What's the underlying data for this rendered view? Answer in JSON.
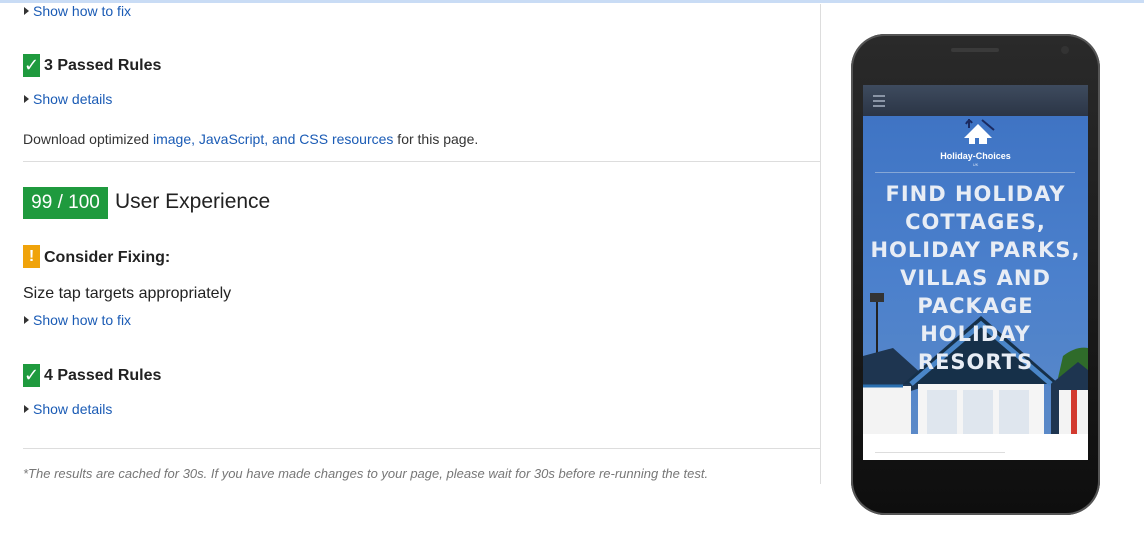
{
  "top_section": {
    "show_how_to_fix_1": "Show how to fix",
    "passed_rules_title": "3 Passed Rules",
    "show_details_1": "Show details",
    "download_prefix": "Download optimized ",
    "download_link": "image, JavaScript, and CSS resources",
    "download_suffix": " for this page."
  },
  "user_experience": {
    "score": "99 / 100",
    "label": "User Experience",
    "consider_fixing_title": "Consider Fixing:",
    "rule_text": "Size tap targets appropriately",
    "show_how_to_fix_2": "Show how to fix",
    "passed_rules_title": "4 Passed Rules",
    "show_details_2": "Show details"
  },
  "cache_note": "*The results are cached for 30s. If you have made changes to your page, please wait for 30s before re-running the test.",
  "phone_preview": {
    "logo_text": "Holiday-Choices",
    "logo_sub": "UK",
    "headline_lines": [
      "FIND HOLIDAY",
      "COTTAGES,",
      "HOLIDAY PARKS,",
      "VILLAS AND",
      "PACKAGE",
      "HOLIDAY",
      "RESORTS"
    ]
  },
  "colors": {
    "pass_green": "#1f9a3e",
    "warn_orange": "#f0a30a",
    "link_blue": "#1a5bb5",
    "hero_blue": "#4b80cc"
  },
  "icons": {
    "check": "checkmark-icon",
    "warning": "exclamation-icon",
    "expand": "triangle-right-icon",
    "menu": "hamburger-menu-icon"
  }
}
